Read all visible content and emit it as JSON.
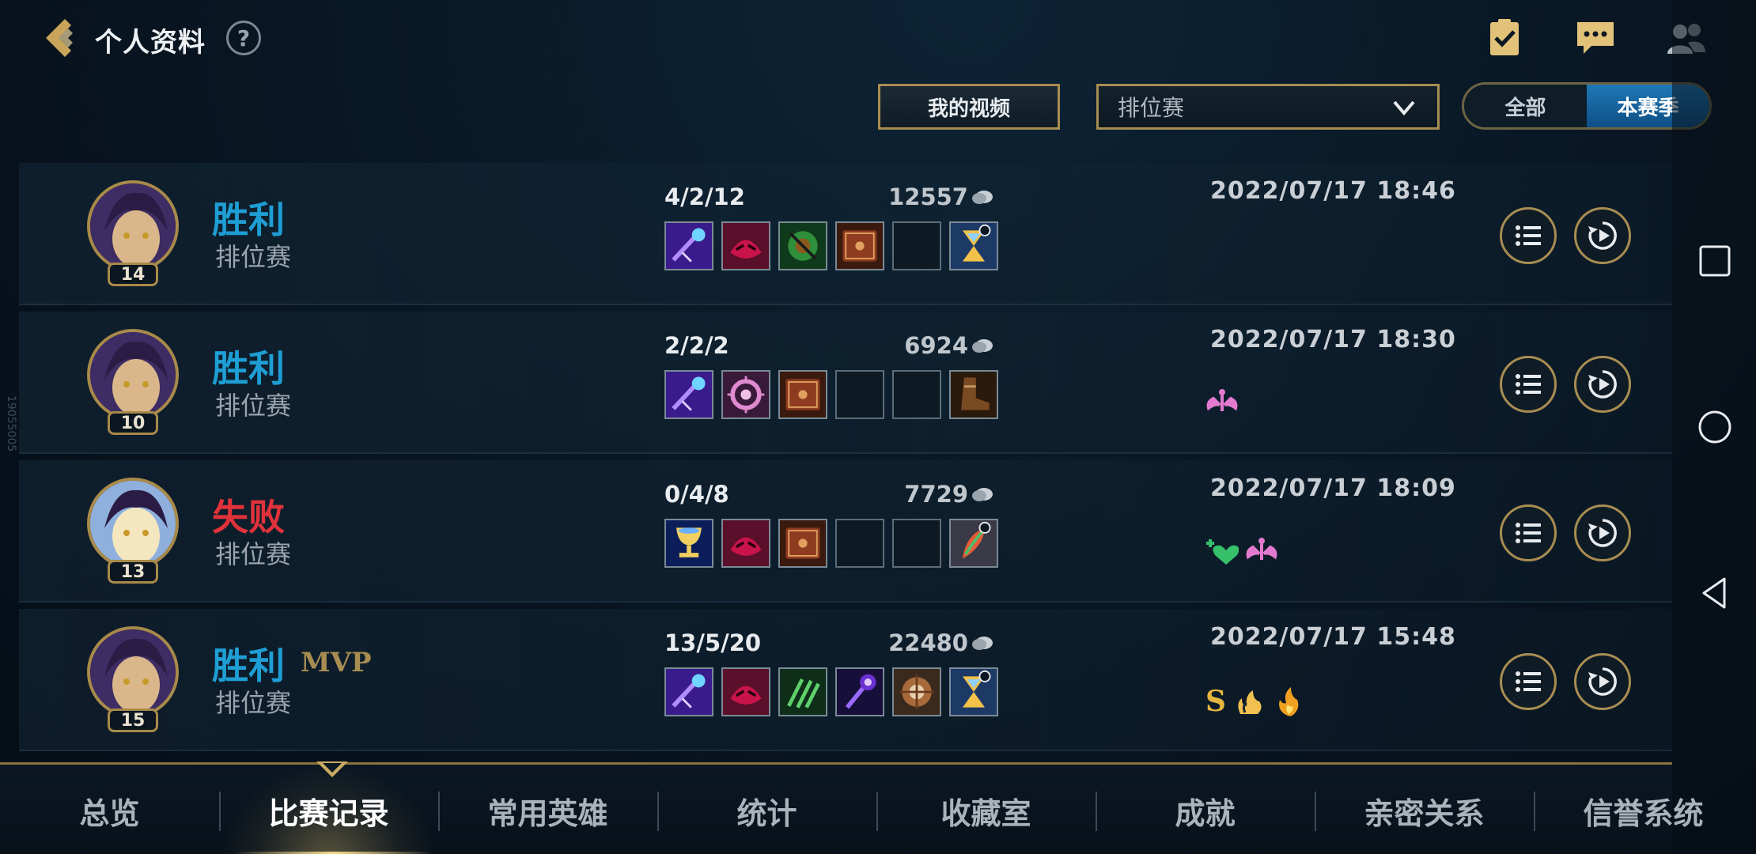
{
  "header": {
    "title": "个人资料",
    "help": "?"
  },
  "toolbar": {
    "my_videos": "我的视频",
    "mode_select": {
      "selected": "排位赛"
    },
    "season_toggle": {
      "all": "全部",
      "current": "本赛季",
      "active": "本赛季"
    }
  },
  "matches": [
    {
      "level": "14",
      "result": "胜利",
      "result_type": "win",
      "mvp": "",
      "queue": "排位赛",
      "kda": "4/2/12",
      "gold": "12557",
      "datetime": "2022/07/17 18:46",
      "items": [
        "magic-staff-icon",
        "red-mask-icon",
        "green-orb-icon",
        "spellbook-icon",
        "empty",
        "hourglass-icon"
      ],
      "awards": []
    },
    {
      "level": "10",
      "result": "胜利",
      "result_type": "win",
      "mvp": "",
      "queue": "排位赛",
      "kda": "2/2/2",
      "gold": "6924",
      "datetime": "2022/07/17 18:30",
      "items": [
        "magic-staff-icon",
        "pink-ring-icon",
        "spellbook-icon",
        "empty",
        "empty",
        "boots-icon"
      ],
      "awards": [
        "angel-icon"
      ]
    },
    {
      "level": "13",
      "result": "失败",
      "result_type": "lose",
      "mvp": "",
      "queue": "排位赛",
      "kda": "0/4/8",
      "gold": "7729",
      "datetime": "2022/07/17 18:09",
      "items": [
        "chalice-icon",
        "red-mask-icon",
        "spellbook-icon",
        "empty",
        "empty",
        "feather-icon"
      ],
      "awards": [
        "heart-plus-icon",
        "angel-icon"
      ]
    },
    {
      "level": "15",
      "result": "胜利",
      "result_type": "win",
      "mvp": "MVP",
      "queue": "排位赛",
      "kda": "13/5/20",
      "gold": "22480",
      "datetime": "2022/07/17 15:48",
      "items": [
        "magic-staff-icon",
        "red-mask-icon",
        "green-claw-icon",
        "purple-scepter-icon",
        "bronze-shield-icon",
        "hourglass-icon"
      ],
      "awards": [
        "S",
        "fire-hand-icon",
        "fire-icon"
      ]
    }
  ],
  "tabs": [
    "总览",
    "比赛记录",
    "常用英雄",
    "统计",
    "收藏室",
    "成就",
    "亲密关系",
    "信誉系统"
  ],
  "active_tab": "比赛记录",
  "watermark": "19055005",
  "colors": {
    "win": "#1e9ed4",
    "lose": "#e0323a",
    "gold_border": "#a88d52",
    "accent_blue": "#1f78b7"
  }
}
